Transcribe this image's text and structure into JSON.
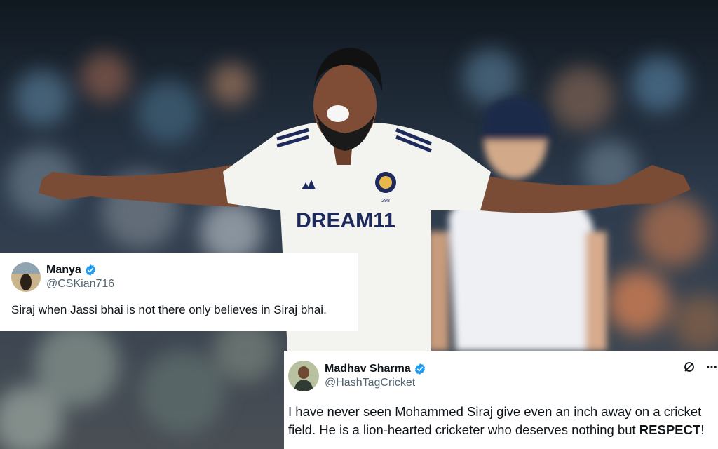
{
  "photo": {
    "jersey_sponsor": "DREAM11",
    "jersey_number": "298"
  },
  "tweets": [
    {
      "name": "Manya",
      "handle": "@CSKian716",
      "text": "Siraj when Jassi bhai is not there only believes in Siraj bhai."
    },
    {
      "name": "Madhav Sharma",
      "handle": "@HashTagCricket",
      "text_main": "I have never seen Mohammed Siraj give even an inch away on a cricket field. He is a lion-hearted cricketer who deserves nothing but ",
      "text_bold": "RESPECT",
      "text_end": "!"
    }
  ],
  "icons": {
    "verified": "verified-badge-icon",
    "grok": "grok-icon",
    "more": "more-options-icon"
  },
  "colors": {
    "verified_blue": "#1d9bf0",
    "handle_gray": "#536471",
    "jersey_navy": "#1f2a5c"
  }
}
